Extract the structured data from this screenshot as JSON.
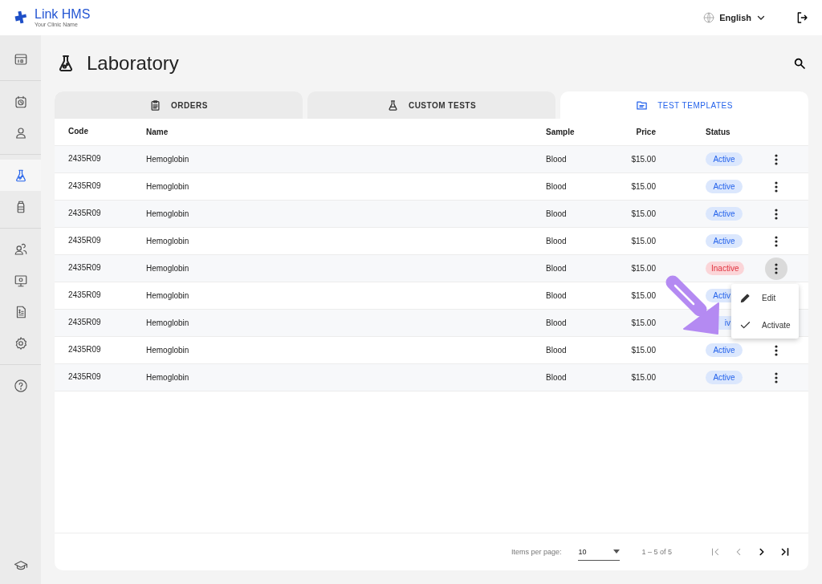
{
  "header": {
    "brand": "Link HMS",
    "clinic": "Your Clinic Name",
    "language": "English"
  },
  "sidebar": {
    "groups": [
      {
        "items": [
          {
            "selected": false
          }
        ]
      },
      {
        "items": [
          {
            "selected": false
          },
          {
            "selected": false
          }
        ]
      },
      {
        "items": [
          {
            "selected": true
          },
          {
            "selected": false
          }
        ]
      },
      {
        "items": [
          {
            "selected": false
          },
          {
            "selected": false
          },
          {
            "selected": false
          },
          {
            "selected": false
          }
        ]
      },
      {
        "items": [
          {
            "selected": false
          }
        ]
      }
    ],
    "footer_items": [
      {
        "selected": false
      }
    ]
  },
  "page": {
    "title": "Laboratory"
  },
  "tabs": [
    {
      "label": "ORDERS",
      "selected": false
    },
    {
      "label": "CUSTOM TESTS",
      "selected": false
    },
    {
      "label": "TEST TEMPLATES",
      "selected": true
    }
  ],
  "table": {
    "columns": [
      "Code",
      "Name",
      "Sample",
      "Price",
      "Status"
    ],
    "rows": [
      {
        "code": "2435R09",
        "name": "Hemoglobin",
        "sample": "Blood",
        "price": "$15.00",
        "status": "Active",
        "active": true,
        "menu_open": false
      },
      {
        "code": "2435R09",
        "name": "Hemoglobin",
        "sample": "Blood",
        "price": "$15.00",
        "status": "Active",
        "active": true,
        "menu_open": false
      },
      {
        "code": "2435R09",
        "name": "Hemoglobin",
        "sample": "Blood",
        "price": "$15.00",
        "status": "Active",
        "active": true,
        "menu_open": false
      },
      {
        "code": "2435R09",
        "name": "Hemoglobin",
        "sample": "Blood",
        "price": "$15.00",
        "status": "Active",
        "active": true,
        "menu_open": false
      },
      {
        "code": "2435R09",
        "name": "Hemoglobin",
        "sample": "Blood",
        "price": "$15.00",
        "status": "Inactive",
        "active": false,
        "menu_open": true
      },
      {
        "code": "2435R09",
        "name": "Hemoglobin",
        "sample": "Blood",
        "price": "$15.00",
        "status": "Activ",
        "active": true,
        "partly_covered": true
      },
      {
        "code": "2435R09",
        "name": "Hemoglobin",
        "sample": "Blood",
        "price": "$15.00",
        "status": "iv",
        "active": true,
        "partly_covered": true
      },
      {
        "code": "2435R09",
        "name": "Hemoglobin",
        "sample": "Blood",
        "price": "$15.00",
        "status": "Active",
        "active": true,
        "menu_open": false
      },
      {
        "code": "2435R09",
        "name": "Hemoglobin",
        "sample": "Blood",
        "price": "$15.00",
        "status": "Active",
        "active": true,
        "menu_open": false
      }
    ]
  },
  "row_menu": {
    "items": [
      {
        "kind": "edit",
        "label": "Edit"
      },
      {
        "kind": "check",
        "label": "Activate"
      }
    ]
  },
  "pagination": {
    "items_per_page_label": "Items per page:",
    "page_size": "10",
    "range": "1 – 5 of 5",
    "buttons": [
      {
        "kind": "first",
        "disabled": true
      },
      {
        "kind": "prev",
        "disabled": true
      },
      {
        "kind": "next",
        "disabled": false
      },
      {
        "kind": "last",
        "disabled": false
      }
    ]
  }
}
